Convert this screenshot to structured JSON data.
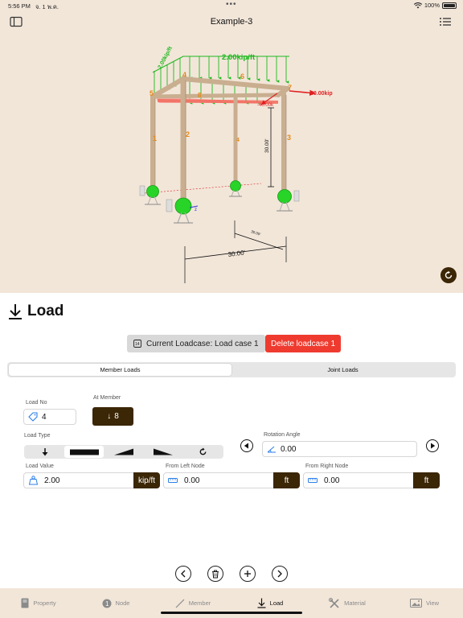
{
  "status": {
    "time": "5:56 PM",
    "date": "จ. 1 พ.ค.",
    "battery": "100%"
  },
  "header": {
    "title": "Example-3",
    "left_icon": "sidebar-icon",
    "right_icon": "list-icon"
  },
  "scene": {
    "top_load_label": "2.00kip/ft",
    "side_load_label": "2.00kip/ft",
    "point_load_x": "40.00kip",
    "point_load_neg": "-40.00k",
    "dim_height": "30.00'",
    "dim_width": "30.00'",
    "dim_depth": "30.00'",
    "node_labels": [
      "4",
      "6",
      "5",
      "7"
    ],
    "member_labels": [
      "1",
      "2",
      "4",
      "3",
      "8"
    ]
  },
  "panel": {
    "title": "Load",
    "loadcase_label": "Current Loadcase: Load case 1",
    "delete_label": "Delete loadcase 1",
    "tabs": [
      {
        "label": "Member Loads",
        "active": true
      },
      {
        "label": "Joint Loads",
        "active": false
      }
    ],
    "load_no": {
      "label": "Load No",
      "value": "4"
    },
    "at_member": {
      "label": "At Member",
      "value": "8"
    },
    "load_type": {
      "label": "Load Type"
    },
    "rotation": {
      "label": "Rotation Angle",
      "value": "0.00"
    },
    "load_value": {
      "label": "Load Value",
      "value": "2.00",
      "unit": "kip/ft"
    },
    "from_left": {
      "label": "From Left Node",
      "value": "0.00",
      "unit": "ft"
    },
    "from_right": {
      "label": "From Right Node",
      "value": "0.00",
      "unit": "ft"
    }
  },
  "tabbar": [
    {
      "label": "Property",
      "icon": "book-icon",
      "active": false
    },
    {
      "label": "Node",
      "icon": "node-icon",
      "badge": "1",
      "active": false
    },
    {
      "label": "Member",
      "icon": "member-icon",
      "active": false
    },
    {
      "label": "Load",
      "icon": "arrow-down-icon",
      "active": true
    },
    {
      "label": "Material",
      "icon": "tools-icon",
      "active": false
    },
    {
      "label": "View",
      "icon": "image-icon",
      "active": false
    }
  ],
  "colors": {
    "accent": "#3b2606",
    "danger": "#ef3b2f",
    "background": "#f2e6d9",
    "load_green": "#1eb81e",
    "load_red": "#e02020"
  }
}
